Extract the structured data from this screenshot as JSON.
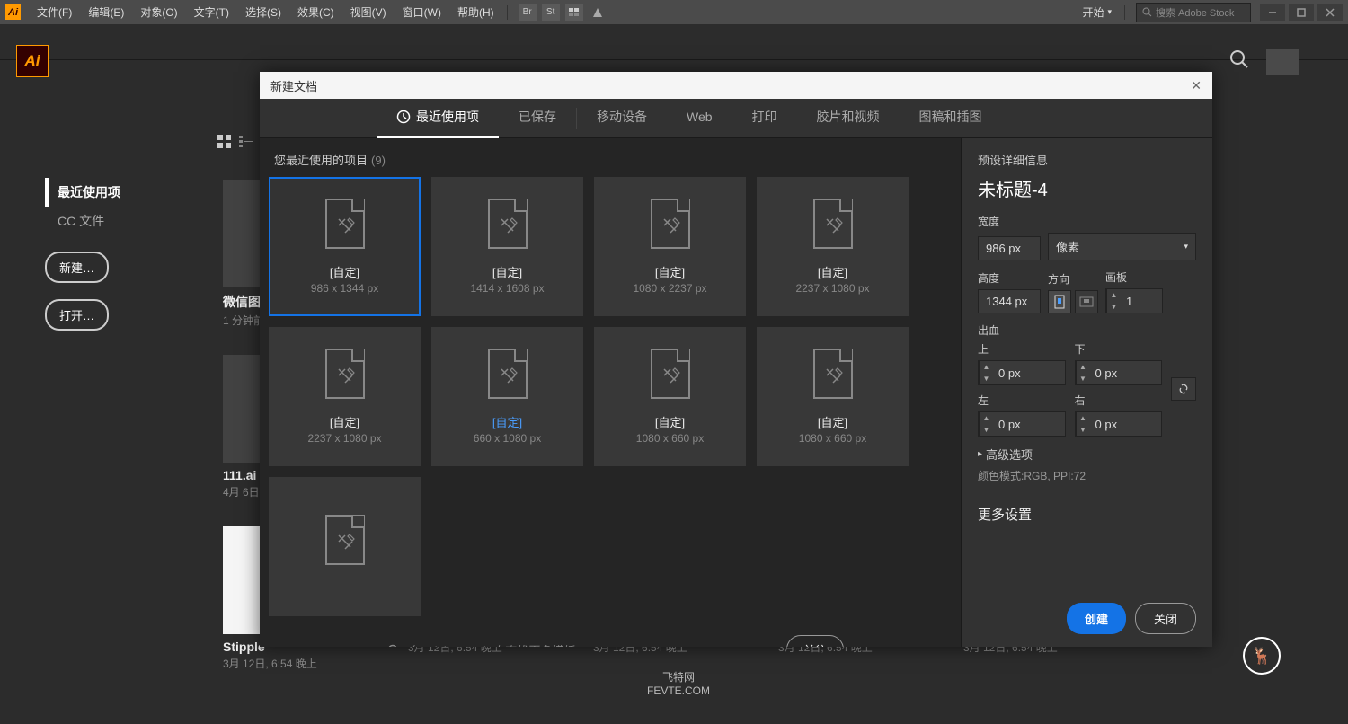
{
  "topbar": {
    "menus": [
      "文件(F)",
      "编辑(E)",
      "对象(O)",
      "文字(T)",
      "选择(S)",
      "效果(C)",
      "视图(V)",
      "窗口(W)",
      "帮助(H)"
    ],
    "icons": [
      "Br",
      "St"
    ],
    "start": "开始",
    "stock_placeholder": "搜索 Adobe Stock"
  },
  "start_screen": {
    "nav_recent": "最近使用项",
    "nav_cc": "CC 文件",
    "btn_new": "新建…",
    "btn_open": "打开…",
    "items": [
      {
        "title": "微信图",
        "meta": "1 分钟前"
      },
      {
        "title": "111.ai",
        "meta": "4月 6日"
      },
      {
        "title": "Stipple",
        "meta": "3月 12日, 6:54 晚上"
      },
      {
        "title": "",
        "meta": "3月 12日, 6:54 晚上"
      },
      {
        "title": "",
        "meta": "3月 12日, 6:54 晚上"
      },
      {
        "title": "",
        "meta": "3月 12日, 6:54 晚上"
      },
      {
        "title": "",
        "meta": "3月 12日, 6:54 晚上"
      }
    ]
  },
  "dialog": {
    "title": "新建文档",
    "tabs": {
      "recent": "最近使用项",
      "saved": "已保存",
      "mobile": "移动设备",
      "web": "Web",
      "print": "打印",
      "film": "胶片和视频",
      "art": "图稿和插图"
    },
    "section": "您最近使用的项目",
    "count": "(9)",
    "presets": [
      {
        "name": "[自定]",
        "dim": "986 x 1344 px",
        "selected": true
      },
      {
        "name": "[自定]",
        "dim": "1414 x 1608 px"
      },
      {
        "name": "[自定]",
        "dim": "1080 x 2237 px"
      },
      {
        "name": "[自定]",
        "dim": "2237 x 1080 px"
      },
      {
        "name": "[自定]",
        "dim": "2237 x 1080 px"
      },
      {
        "name": "[自定]",
        "dim": "660 x 1080 px",
        "blue": true
      },
      {
        "name": "[自定]",
        "dim": "1080 x 660 px"
      },
      {
        "name": "[自定]",
        "dim": "1080 x 660 px"
      },
      {
        "name": "",
        "dim": ""
      }
    ],
    "stock_placeholder": "在 Adobe Stock 上查找更多模板",
    "goto": "前往",
    "details": {
      "header": "预设详细信息",
      "name": "未标题-4",
      "width_label": "宽度",
      "width": "986 px",
      "unit": "像素",
      "height_label": "高度",
      "height": "1344 px",
      "orient_label": "方向",
      "artboards_label": "画板",
      "artboards": "1",
      "bleed_label": "出血",
      "top": "上",
      "bottom": "下",
      "left": "左",
      "right": "右",
      "bleed_val": "0 px",
      "advanced": "高级选项",
      "mode": "颜色模式:RGB, PPI:72",
      "more": "更多设置"
    },
    "create": "创建",
    "close": "关闭"
  },
  "watermark": {
    "a": "飞特网",
    "b": "FEVTE.COM"
  }
}
